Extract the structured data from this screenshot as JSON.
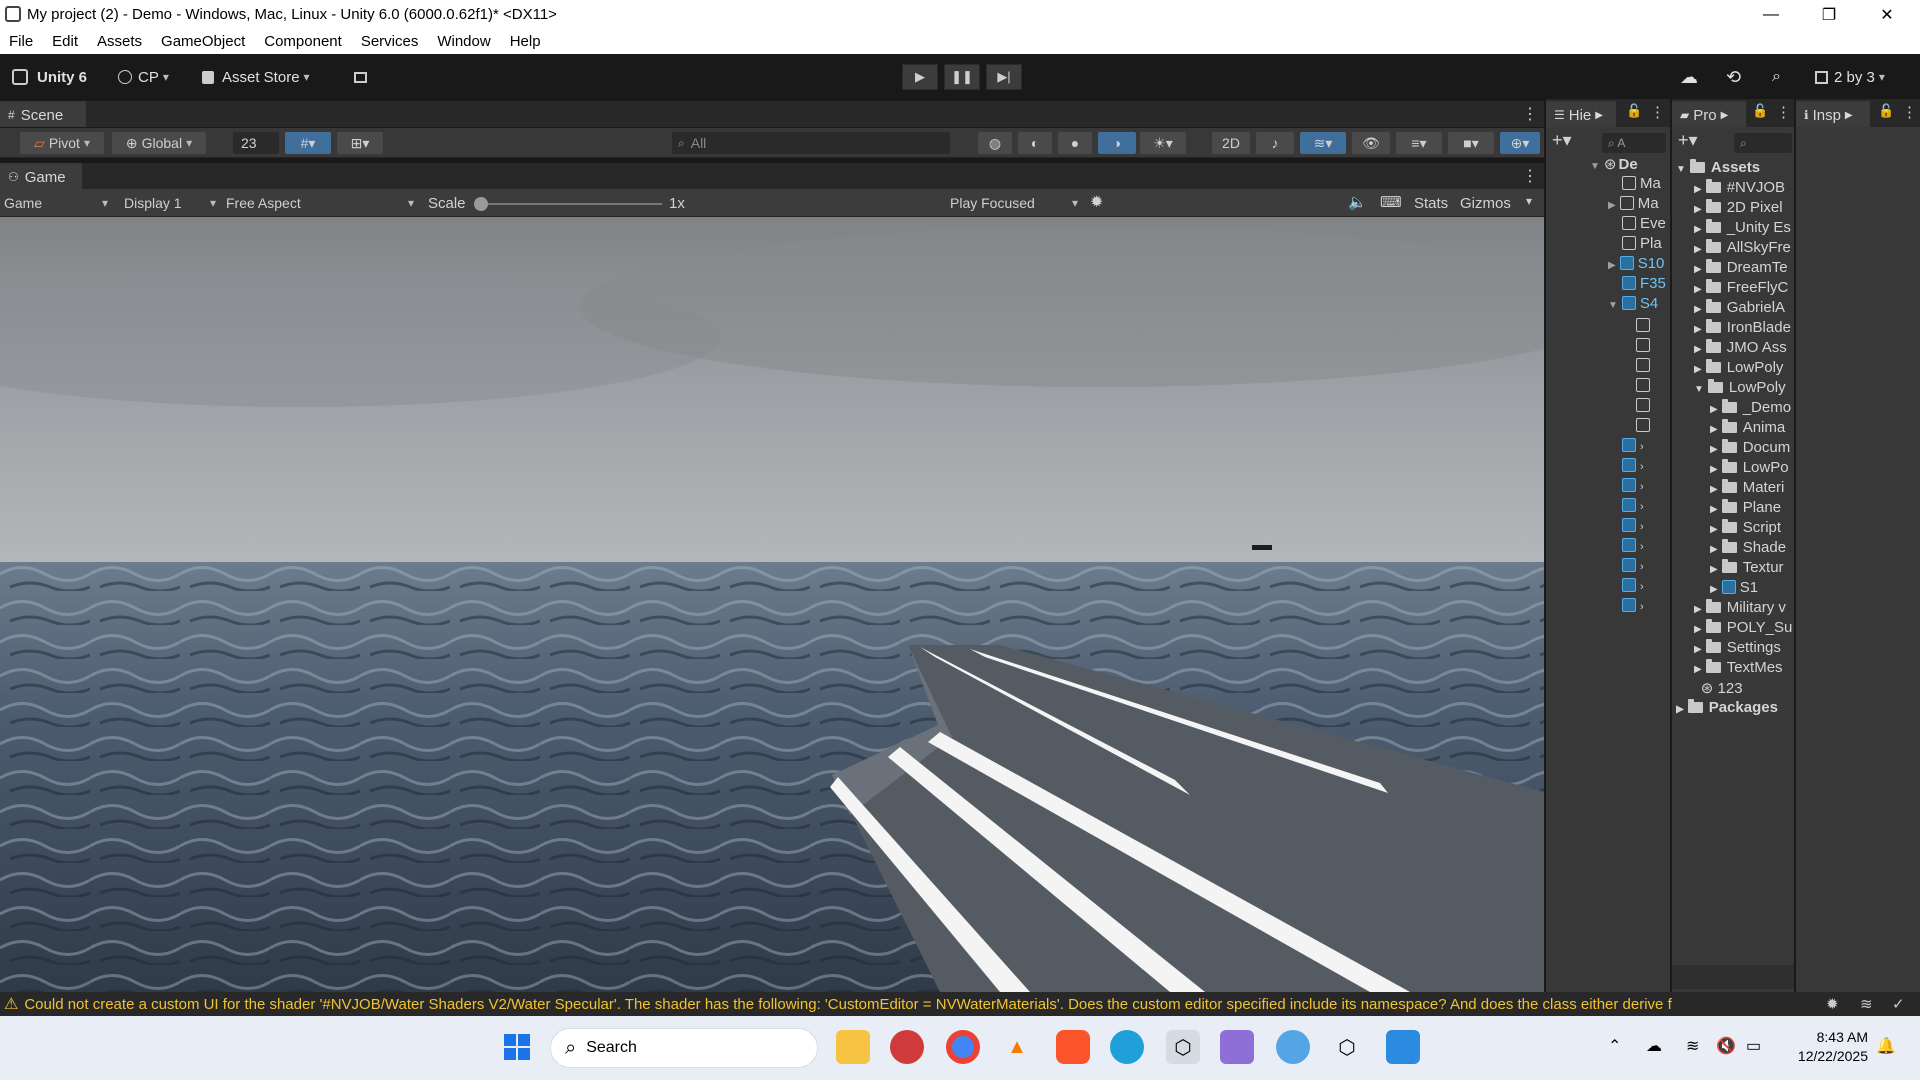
{
  "window": {
    "title": "My project (2) - Demo - Windows, Mac, Linux - Unity 6.0 (6000.0.62f1)* <DX11>"
  },
  "menu": [
    "File",
    "Edit",
    "Assets",
    "GameObject",
    "Component",
    "Services",
    "Window",
    "Help"
  ],
  "toolbar": {
    "unity_label": "Unity 6",
    "account": "CP",
    "asset_store": "Asset Store",
    "layout": "2 by 3"
  },
  "scene": {
    "tab": "Scene",
    "pivot": "Pivot",
    "global": "Global",
    "grid_value": "23",
    "search_placeholder": "All"
  },
  "game": {
    "tab": "Game",
    "mode": "Game",
    "display": "Display 1",
    "aspect": "Free Aspect",
    "scale_label": "Scale",
    "scale_value": "1x",
    "play_mode": "Play Focused",
    "stats": "Stats",
    "gizmos": "Gizmos"
  },
  "hierarchy": {
    "tab": "Hie",
    "search_placeholder": "A",
    "items": [
      "De",
      "Ma",
      "Ma",
      "Eve",
      "Pla",
      "S10",
      "F35",
      "S4"
    ]
  },
  "project": {
    "tab": "Pro",
    "root": "Assets",
    "folders": [
      "#NVJOB",
      "2D Pixel",
      "_Unity Es",
      "AllSkyFre",
      "DreamTe",
      "FreeFlyC",
      "GabrielA",
      "IronBlade",
      "JMO Ass",
      "LowPoly",
      "LowPoly"
    ],
    "subfolders": [
      "_Demo",
      "Anima",
      "Docum",
      "LowPo",
      "Materi",
      "Plane",
      "Script",
      "Shade",
      "Textur"
    ],
    "prefab": "S1",
    "more_folders": [
      "Military v",
      "POLY_Su",
      "Settings",
      "TextMes"
    ],
    "scene_asset": "123",
    "packages": "Packages"
  },
  "inspector": {
    "tab": "Insp"
  },
  "console": {
    "message": "Could not create a custom UI for the shader '#NVJOB/Water Shaders V2/Water Specular'. The shader has the following: 'CustomEditor = NVWaterMaterials'. Does the custom editor specified include its namespace? And does the class either derive f"
  },
  "taskbar": {
    "search": "Search",
    "time": "8:43 AM",
    "date": "12/22/2025"
  },
  "colors": {
    "accent": "#4fb0f0",
    "warning": "#f1c232",
    "ocean": "#3f4d5e",
    "sky": "#9a9fa3"
  }
}
